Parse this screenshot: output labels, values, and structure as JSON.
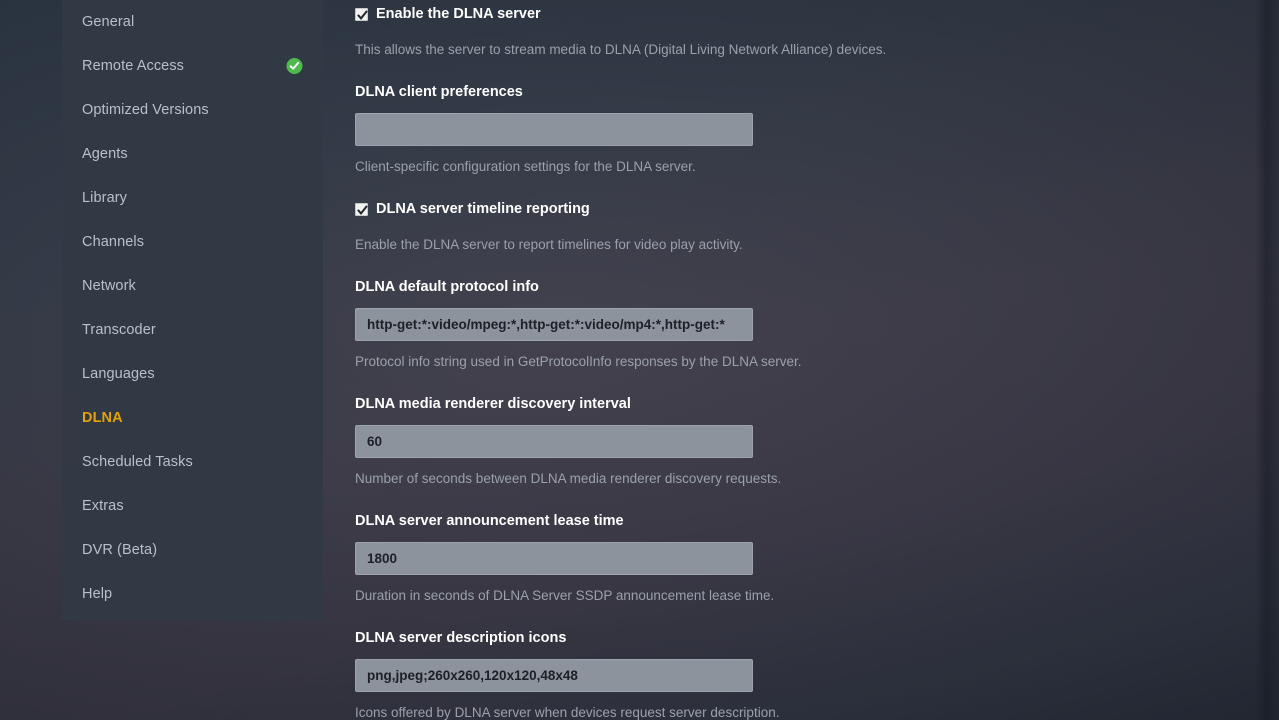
{
  "theme": {
    "accent": "#e5a00d",
    "sidebar_bg": "#313944",
    "nav_text": "#b9c0c9",
    "input_bg": "#8d939c",
    "desc_text": "#9aa1ab",
    "status_green": "#4cbb4c"
  },
  "sidebar": {
    "items": [
      {
        "label": "General",
        "active": false,
        "badge": null
      },
      {
        "label": "Remote Access",
        "active": false,
        "badge": "check-circle-icon"
      },
      {
        "label": "Optimized Versions",
        "active": false,
        "badge": null
      },
      {
        "label": "Agents",
        "active": false,
        "badge": null
      },
      {
        "label": "Library",
        "active": false,
        "badge": null
      },
      {
        "label": "Channels",
        "active": false,
        "badge": null
      },
      {
        "label": "Network",
        "active": false,
        "badge": null
      },
      {
        "label": "Transcoder",
        "active": false,
        "badge": null
      },
      {
        "label": "Languages",
        "active": false,
        "badge": null
      },
      {
        "label": "DLNA",
        "active": true,
        "badge": null
      },
      {
        "label": "Scheduled Tasks",
        "active": false,
        "badge": null
      },
      {
        "label": "Extras",
        "active": false,
        "badge": null
      },
      {
        "label": "DVR (Beta)",
        "active": false,
        "badge": null
      },
      {
        "label": "Help",
        "active": false,
        "badge": null
      }
    ]
  },
  "settings": {
    "enable_server": {
      "label": "Enable the DLNA server",
      "checked": true,
      "description": "This allows the server to stream media to DLNA (Digital Living Network Alliance) devices."
    },
    "client_preferences": {
      "label": "DLNA client preferences",
      "value": "",
      "placeholder": "",
      "description": "Client-specific configuration settings for the DLNA server."
    },
    "timeline_reporting": {
      "label": "DLNA server timeline reporting",
      "checked": true,
      "description": "Enable the DLNA server to report timelines for video play activity."
    },
    "default_protocol_info": {
      "label": "DLNA default protocol info",
      "value": "http-get:*:video/mpeg:*,http-get:*:video/mp4:*,http-get:*",
      "description": "Protocol info string used in GetProtocolInfo responses by the DLNA server."
    },
    "renderer_discovery_interval": {
      "label": "DLNA media renderer discovery interval",
      "value": "60",
      "description": "Number of seconds between DLNA media renderer discovery requests."
    },
    "announcement_lease_time": {
      "label": "DLNA server announcement lease time",
      "value": "1800",
      "description": "Duration in seconds of DLNA Server SSDP announcement lease time."
    },
    "description_icons": {
      "label": "DLNA server description icons",
      "value": "png,jpeg;260x260,120x120,48x48",
      "description": "Icons offered by DLNA server when devices request server description."
    }
  }
}
